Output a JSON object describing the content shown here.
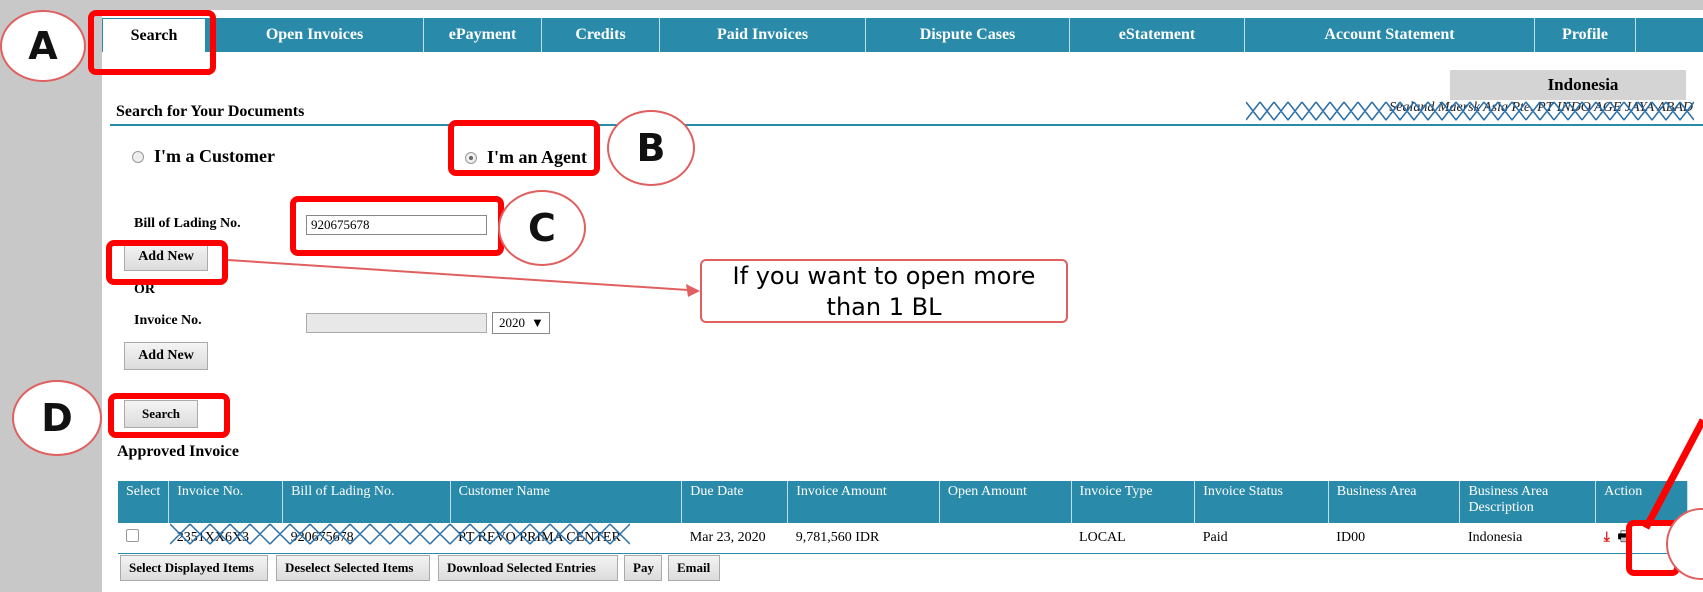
{
  "tabs": [
    {
      "label": "Search"
    },
    {
      "label": "Open Invoices"
    },
    {
      "label": "ePayment"
    },
    {
      "label": "Credits"
    },
    {
      "label": "Paid Invoices"
    },
    {
      "label": "Dispute Cases"
    },
    {
      "label": "eStatement"
    },
    {
      "label": "Account Statement"
    },
    {
      "label": "Profile"
    }
  ],
  "header": {
    "country": "Indonesia",
    "company": "Sealand Maersk Asia Pte. PT INDO AGE JAYA ABAD",
    "section_title": "Search for Your Documents"
  },
  "role": {
    "customer_label": "I'm a Customer",
    "agent_label": "I'm an Agent",
    "selected": "agent"
  },
  "form": {
    "bl_label": "Bill of Lading No.",
    "bl_value": "920675678",
    "add_new_label": "Add New",
    "or_label": "OR",
    "invoice_label": "Invoice No.",
    "invoice_value": "",
    "year_value": "2020",
    "search_label": "Search"
  },
  "results": {
    "title": "Approved Invoice",
    "columns": [
      "Select",
      "Invoice No.",
      "Bill of Lading No.",
      "Customer Name",
      "Due Date",
      "Invoice Amount",
      "Open Amount",
      "Invoice Type",
      "Invoice Status",
      "Business Area",
      "Business Area Description",
      "Action"
    ],
    "rows": [
      {
        "invoice_no": "2351XX6X3",
        "bl_no": "920675678",
        "customer": "PT REVO PRIMA CENTER",
        "due_date": "Mar 23, 2020",
        "amount": "9,781,560 IDR",
        "open_amount": "",
        "type": "LOCAL",
        "status": "Paid",
        "business_area": "ID00",
        "area_desc": "Indonesia"
      }
    ]
  },
  "bottom_buttons": [
    "Select Displayed Items",
    "Deselect Selected Items",
    "Download Selected Entries",
    "Pay",
    "Email"
  ],
  "annotations": {
    "a": "A",
    "b": "B",
    "c": "C",
    "d": "D",
    "callout": "If you want to open more than 1 BL",
    "accent_color": "#ff0000"
  },
  "colors": {
    "nav": "#2a8aaa",
    "background_bar": "#c8c8c8"
  }
}
